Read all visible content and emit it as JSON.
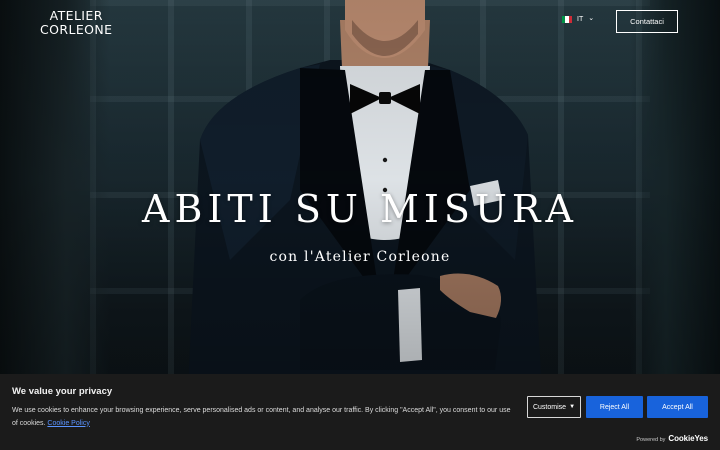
{
  "header": {
    "logo_line1": "ATELIER",
    "logo_line2": "CORLEONE",
    "language": "IT",
    "language_flag_colors": [
      "#009246",
      "#ffffff",
      "#ce2b37"
    ],
    "contact_label": "Contattaci"
  },
  "hero": {
    "title": "ABITI SU MISURA",
    "subtitle": "con l'Atelier Corleone"
  },
  "cookie_banner": {
    "title": "We value your privacy",
    "text": "We use cookies to enhance your browsing experience, serve personalised ads or content, and analyse our traffic. By clicking \"Accept All\", you consent to our use of cookies.",
    "policy_link": "Cookie Policy",
    "customise_label": "Customise",
    "reject_label": "Reject All",
    "accept_label": "Accept All",
    "powered_by": "Powered by",
    "powered_brand": "CookieYes",
    "accent_color": "#1863dc",
    "background_color": "#1b1b1b"
  },
  "icons": {
    "language_caret": "chevron-down-icon",
    "customise_caret": "caret-down-icon"
  }
}
